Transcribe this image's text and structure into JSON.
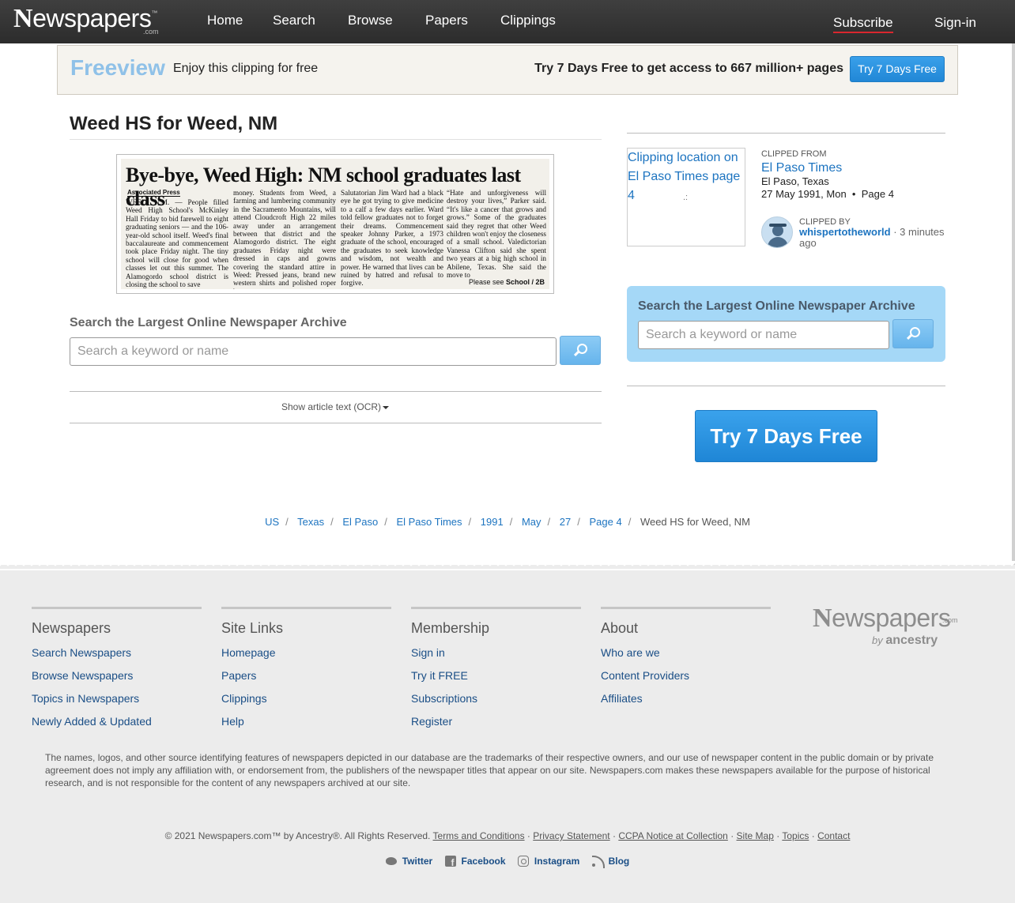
{
  "header": {
    "logo_letter": "N",
    "logo_rest": "ewspapers",
    "logo_tm": "™",
    "logo_com": ".com",
    "nav": [
      "Home",
      "Search",
      "Browse",
      "Papers",
      "Clippings"
    ],
    "subscribe": "Subscribe",
    "signin": "Sign-in"
  },
  "freeview": {
    "brand": "Freeview",
    "text": "Enjoy this clipping for free",
    "cta": "Try 7 Days Free to get access to 667 million+ pages",
    "button": "Try 7 Days Free"
  },
  "article": {
    "title": "Weed HS for Weed, NM",
    "clip": {
      "headline": "Bye-bye, Weed High: NM school graduates last class",
      "byline": "Associated Press",
      "col1": "WEED, N.M. — People filled Weed High School's McKinley Hall Friday to bid farewell to eight graduating seniors — and the 106-year-old school itself. Weed's final baccalaureate and commencement took place Friday night. The tiny school will close for good when classes let out this summer. The Alamogordo school district is closing the school to save",
      "col2": "money. Students from Weed, a farming and lumbering community in the Sacramento Mountains, will attend Cloudcroft High 22 miles away under an arrangement between that district and the Alamogordo district. The eight graduates Friday night were dressed in caps and gowns covering the standard attire in Weed: Pressed jeans, brand new western shirts and polished roper boots.",
      "col3": "Salutatorian Jim Ward had a black eye he got trying to give medicine to a calf a few days earlier. Ward told fellow graduates not to forget their dreams. Commencement speaker Johnny Parker, a 1973 graduate of the school, encouraged the graduates to seek knowledge and wisdom, not wealth and power. He warned that lives can be ruined by hatred and refusal to forgive.",
      "col4": "“Hate and unforgiveness will destroy your lives,” Parker said. “It's like a cancer that grows and grows.” Some of the graduates said they regret that other Weed children won't enjoy the closeness of a small school. Valedictorian Vanessa Clifton said she spent two years at a big high school in Abilene, Texas. She said the move to",
      "see_prefix": "Please see",
      "see_ref": "School / 2B"
    },
    "search_heading": "Search the Largest Online Newspaper Archive",
    "search_placeholder": "Search a keyword or name",
    "ocr_toggle": "Show article text (OCR)"
  },
  "sidebar": {
    "thumb_alt": "Clipping location on El Paso Times page 4",
    "clipped_from_label": "Clipped from",
    "paper": "El Paso Times",
    "location": "El Paso, Texas",
    "date": "27 May 1991, Mon",
    "bullet": "•",
    "page": "Page 4",
    "clipped_by_label": "Clipped by",
    "user": "whispertotheworld",
    "time_sep": "·",
    "time": "3 minutes ago",
    "search_heading": "Search the Largest Online Newspaper Archive",
    "search_placeholder": "Search a keyword or name",
    "big_button": "Try 7 Days Free"
  },
  "breadcrumbs": {
    "sep": "/",
    "links": [
      "US",
      "Texas",
      "El Paso",
      "El Paso Times",
      "1991",
      "May",
      "27",
      "Page 4"
    ],
    "current": "Weed HS for Weed, NM"
  },
  "footer": {
    "columns": [
      {
        "title": "Newspapers",
        "links": [
          "Search Newspapers",
          "Browse Newspapers",
          "Topics in Newspapers",
          "Newly Added & Updated"
        ]
      },
      {
        "title": "Site Links",
        "links": [
          "Homepage",
          "Papers",
          "Clippings",
          "Help"
        ]
      },
      {
        "title": "Membership",
        "links": [
          "Sign in",
          "Try it FREE",
          "Subscriptions",
          "Register"
        ]
      },
      {
        "title": "About",
        "links": [
          "Who are we",
          "Content Providers",
          "Affiliates"
        ]
      }
    ],
    "logo_letter": "N",
    "logo_rest": "ewspapers",
    "logo_com": ".com",
    "logo_by": "by",
    "logo_ancestry": "ancestry",
    "disclaimer": "The names, logos, and other source identifying features of newspapers depicted in our database are the trademarks of their respective owners, and our use of newspaper content in the public domain or by private agreement does not imply any affiliation with, or endorsement from, the publishers of the newspaper titles that appear on our site. Newspapers.com makes these newspapers available for the purpose of historical research, and is not responsible for the content of any newspapers archived at our site.",
    "copyright": "© 2021 Newspapers.com™ by Ancestry®. All Rights Reserved.",
    "legal_sep": "·",
    "legal_links": [
      "Terms and Conditions",
      "Privacy Statement",
      "CCPA Notice at Collection",
      "Site Map",
      "Topics",
      "Contact"
    ],
    "social": [
      "Twitter",
      "Facebook",
      "Instagram",
      "Blog"
    ]
  }
}
